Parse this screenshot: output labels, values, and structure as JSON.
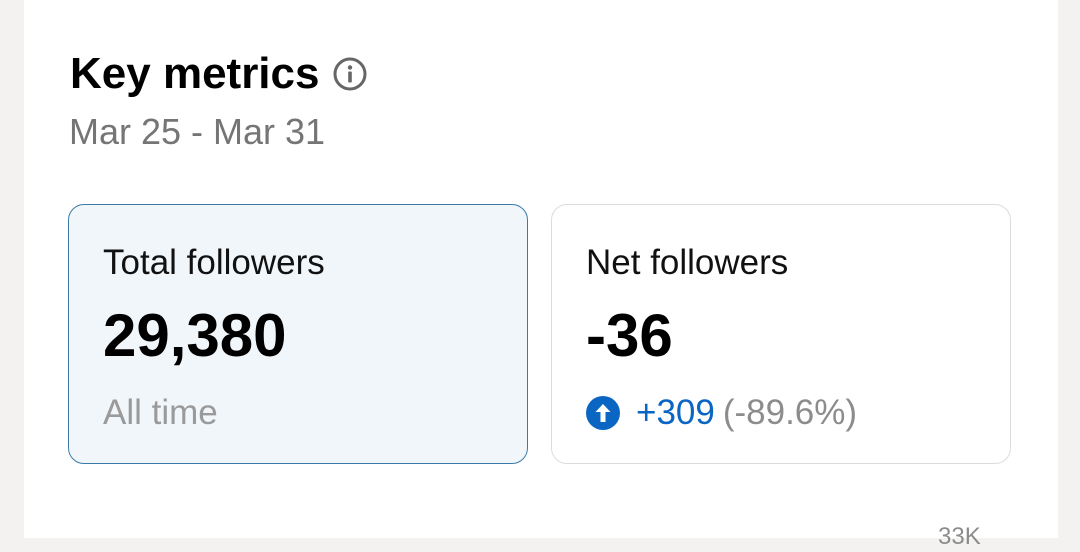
{
  "header": {
    "title": "Key metrics",
    "date_range": "Mar 25 - Mar 31"
  },
  "cards": [
    {
      "label": "Total followers",
      "value": "29,380",
      "sub": "All time",
      "selected": true
    },
    {
      "label": "Net followers",
      "value": "-36",
      "change_value": "+309",
      "change_pct": "(-89.6%)",
      "selected": false
    }
  ],
  "chart": {
    "top_tick": "33K"
  },
  "icons": {
    "info": "info-icon",
    "change": "arrow-up-circle-icon"
  },
  "colors": {
    "accent": "#0a66c2",
    "selected_border": "#3a7ba6",
    "selected_bg": "#f1f6fb"
  }
}
